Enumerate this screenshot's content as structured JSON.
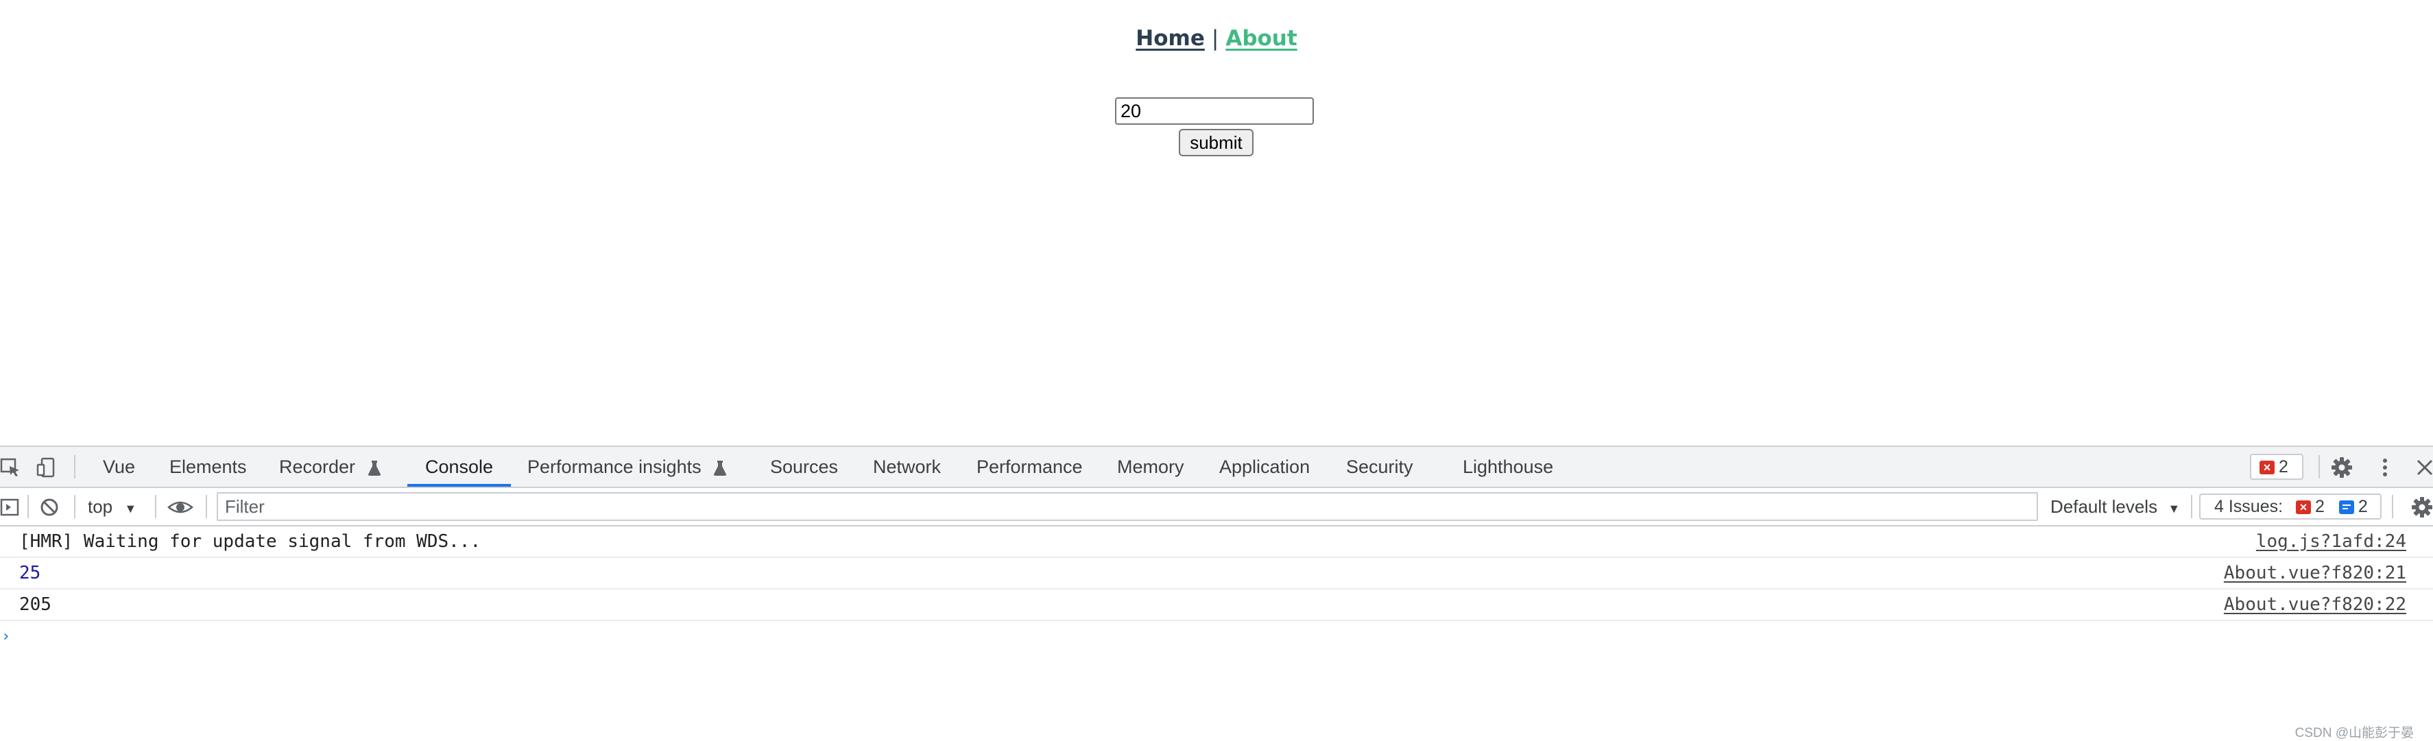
{
  "page": {
    "nav": {
      "home": "Home",
      "separator": "|",
      "about": "About"
    },
    "input_value": "20",
    "submit_label": "submit"
  },
  "devtools": {
    "tabs": [
      {
        "label": "Vue"
      },
      {
        "label": "Elements"
      },
      {
        "label": "Recorder"
      },
      {
        "label": "Console",
        "active": true
      },
      {
        "label": "Performance insights"
      },
      {
        "label": "Sources"
      },
      {
        "label": "Network"
      },
      {
        "label": "Performance"
      },
      {
        "label": "Memory"
      },
      {
        "label": "Application"
      },
      {
        "label": "Security"
      },
      {
        "label": "Lighthouse"
      }
    ],
    "error_count": "2",
    "toolbar": {
      "context": "top",
      "filter_placeholder": "Filter",
      "levels": "Default levels",
      "issues_label": "4 Issues:",
      "issues_errors": "2",
      "issues_info": "2"
    },
    "messages": [
      {
        "text": "[HMR] Waiting for update signal from WDS...",
        "source": "log.js?1afd:24"
      },
      {
        "text": "25",
        "source": "About.vue?f820:21"
      },
      {
        "text": "205",
        "source": "About.vue?f820:22"
      }
    ],
    "prompt": "›"
  },
  "watermark": "CSDN @山能彭于晏",
  "colors": {
    "accent": "#1a73e8",
    "vue_green": "#42b983",
    "nav_dark": "#2c3e50",
    "error": "#d93025"
  }
}
